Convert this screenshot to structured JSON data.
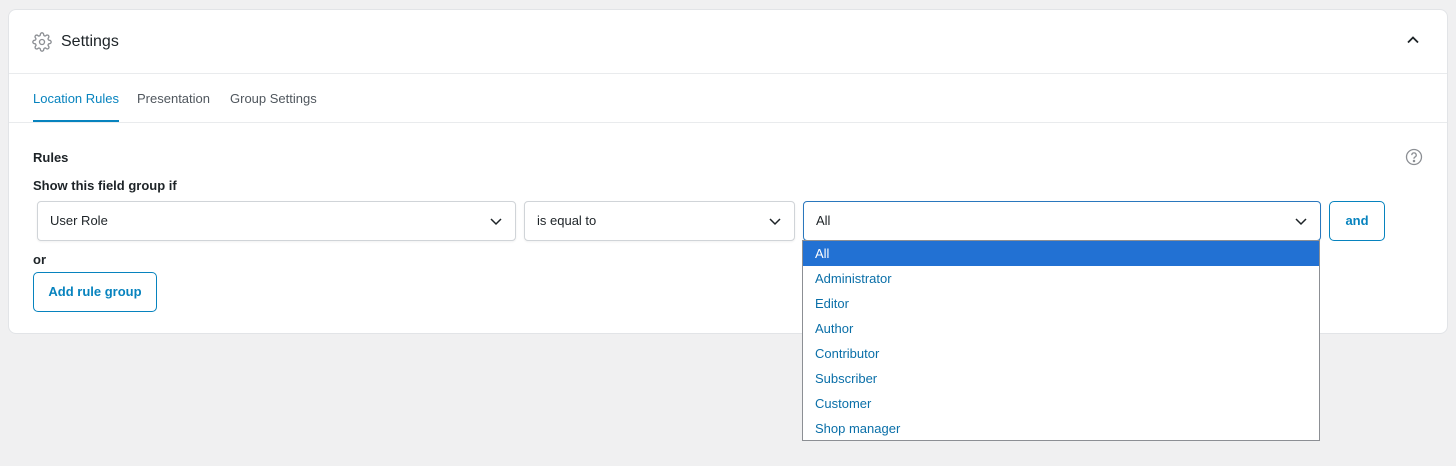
{
  "panel": {
    "title": "Settings",
    "icon": "gear-icon",
    "collapse_icon": "chevron-up-icon"
  },
  "tabs": [
    {
      "label": "Location Rules",
      "active": true
    },
    {
      "label": "Presentation",
      "active": false
    },
    {
      "label": "Group Settings",
      "active": false
    }
  ],
  "rules": {
    "heading": "Rules",
    "show_if_label": "Show this field group if",
    "param_value": "User Role",
    "operator_value": "is equal to",
    "value_value": "All",
    "and_label": "and",
    "or_label": "or",
    "add_group_label": "Add rule group"
  },
  "dropdown": {
    "options": [
      "All",
      "Administrator",
      "Editor",
      "Author",
      "Contributor",
      "Subscriber",
      "Customer",
      "Shop manager"
    ],
    "selected_index": 0
  },
  "colors": {
    "accent": "#0783be",
    "highlight": "#2271d3",
    "background": "#f0f0f1"
  }
}
